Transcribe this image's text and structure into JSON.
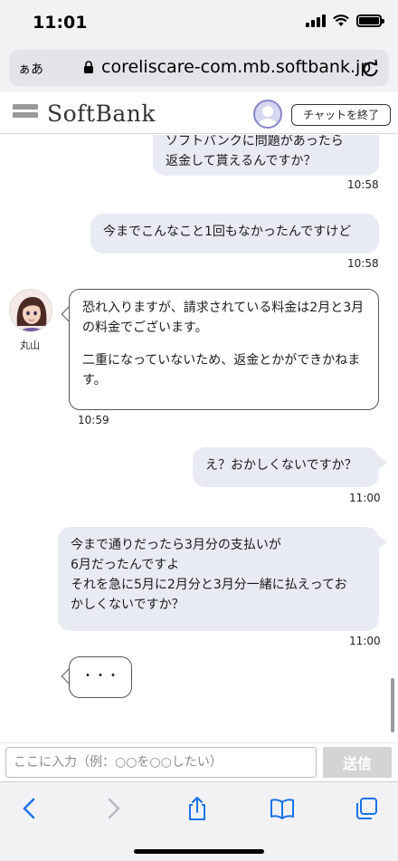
{
  "status_bar": {
    "time": "11:01"
  },
  "browser": {
    "aa_label": "ぁあ",
    "url": "coreliscare-com.mb.softbank.jp"
  },
  "header": {
    "brand": "SoftBank",
    "end_chat_label": "チャットを終了"
  },
  "chat": {
    "messages": [
      {
        "from": "user",
        "lines": [
          "ソフトバンクに問題があったら",
          "返金して貰えるんですか？"
        ],
        "time": "10:58"
      },
      {
        "from": "user",
        "lines": [
          "今までこんなこと1回もなかったんですけど"
        ],
        "time": "10:58"
      },
      {
        "from": "agent",
        "agent_name": "丸山",
        "paragraphs": [
          "恐れ入りますが、請求されている料金は2月と3月の料金でございます。",
          "二重になっていないため、返金とかができかねます。"
        ],
        "time": "10:59"
      },
      {
        "from": "user",
        "lines": [
          "え？おかしくないですか？"
        ],
        "time": "11:00"
      },
      {
        "from": "user",
        "lines": [
          "今まで通りだったら3月分の支払いが",
          "6月だったんですよ",
          "それを急に5月に2月分と3月分一緒に払えってお",
          "かしくないですか？"
        ],
        "time": "11:00"
      },
      {
        "from": "agent",
        "typing": "・・・"
      }
    ]
  },
  "input": {
    "placeholder": "ここに入力（例：○○を○○したい）",
    "send_label": "送信"
  },
  "colors": {
    "user_bubble": "#e9ebf4",
    "agent_bubble_border": "#555555",
    "send_button": "#d4d4d4",
    "browser_chrome": "#f2f2f5",
    "toolbar_icon_active": "#1a73e8"
  },
  "icons": [
    "wifi-icon",
    "battery-icon",
    "lock-icon",
    "reload-icon",
    "back-icon",
    "forward-icon",
    "share-icon",
    "bookmarks-icon",
    "tabs-icon"
  ]
}
